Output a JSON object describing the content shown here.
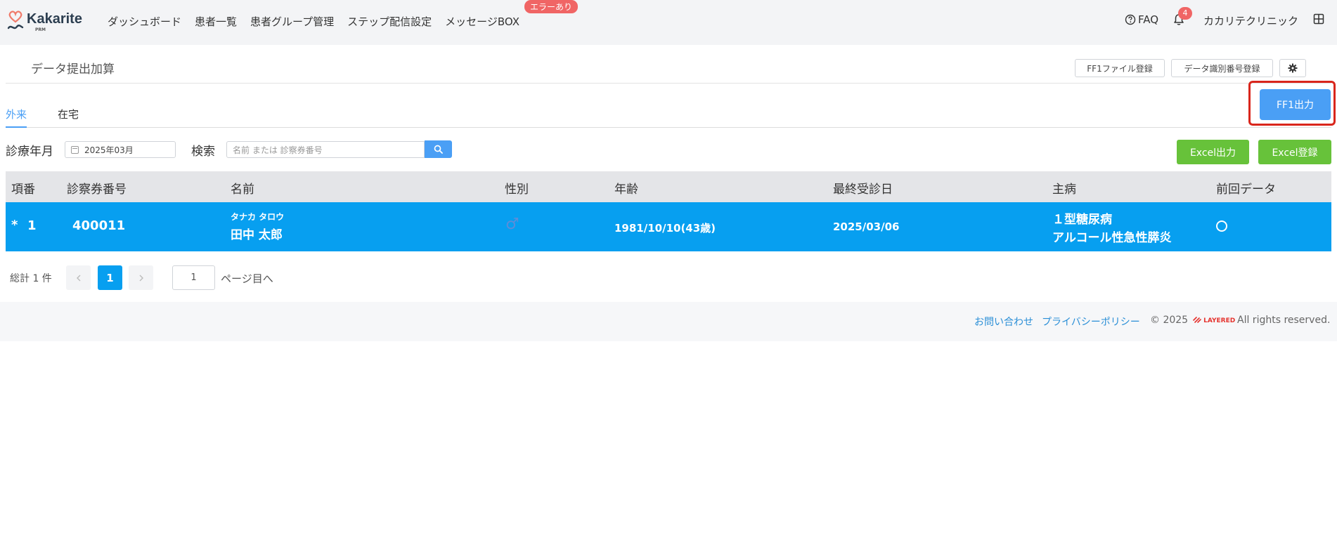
{
  "header": {
    "logo_text": "Kakarite",
    "logo_sub": "PRM",
    "nav": [
      "ダッシュボード",
      "患者一覧",
      "患者グループ管理",
      "ステップ配信設定",
      "メッセージBOX"
    ],
    "error_badge": "エラーあり",
    "faq": "FAQ",
    "notification_count": "4",
    "clinic_name": "カカリテクリニック"
  },
  "page": {
    "title": "データ提出加算",
    "ff1_register_label": "FF1ファイル登録",
    "data_id_register_label": "データ識別番号登録",
    "ff1_output_label": "FF1出力"
  },
  "tabs": [
    "外来",
    "在宅"
  ],
  "filters": {
    "month_label": "診療年月",
    "month_value": "2025年03月",
    "search_label": "検索",
    "search_placeholder": "名前 または 診察券番号",
    "excel_output_label": "Excel出力",
    "excel_register_label": "Excel登録"
  },
  "table": {
    "headers": [
      "項番",
      "診察券番号",
      "名前",
      "性別",
      "年齢",
      "最終受診日",
      "主病",
      "前回データ"
    ],
    "rows": [
      {
        "mark": "*",
        "index": "1",
        "card_no": "400011",
        "name_kana": "タナカ タロウ",
        "name": "田中 太郎",
        "gender": "♂",
        "birth_age": "1981/10/10(43歳)",
        "last_visit": "2025/03/06",
        "disease_1": "１型糖尿病",
        "disease_2": "アルコール性急性膵炎"
      }
    ]
  },
  "pagination": {
    "total": "総計 1 件",
    "current_page": "1",
    "goto_value": "1",
    "goto_label": "ページ目へ"
  },
  "footer": {
    "contact": "お問い合わせ",
    "privacy": "プライバシーポリシー",
    "copyright": "© 2025",
    "company_logo": "LAYERED",
    "rights": "All rights reserved."
  },
  "colors": {
    "primary": "#4a9ff5",
    "row_highlight": "#079ff0",
    "success": "#67c23a",
    "danger": "#f06565",
    "highlight_frame": "#d9261c"
  }
}
